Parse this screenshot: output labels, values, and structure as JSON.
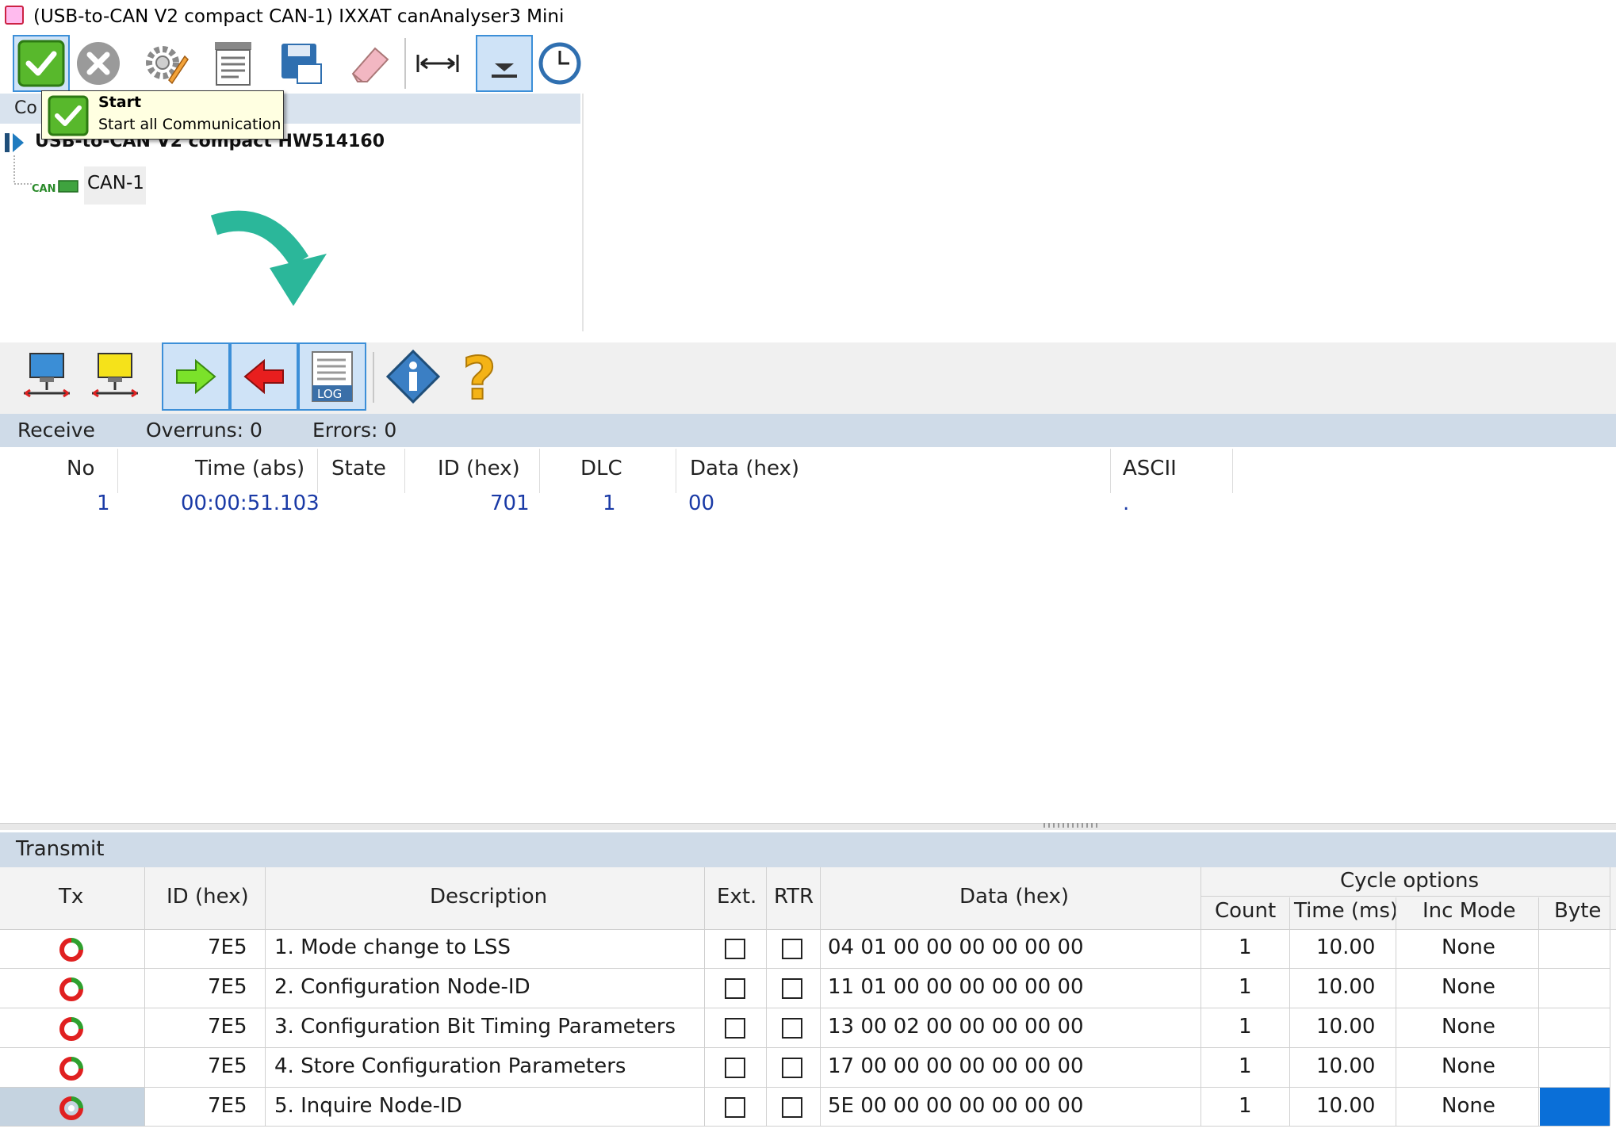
{
  "window": {
    "title": "(USB-to-CAN V2 compact  CAN-1) IXXAT canAnalyser3 Mini"
  },
  "toolbar": {
    "icons": [
      "start-check-icon",
      "stop-x-icon",
      "settings-gear-icon",
      "print-report-icon",
      "save-disk-icon",
      "eraser-icon",
      "width-arrows-icon",
      "autoscroll-icon",
      "clock-icon"
    ]
  },
  "tree": {
    "header": "Co",
    "device": "USB-to-CAN V2 compact  HW514160",
    "channel": "CAN-1"
  },
  "tooltip": {
    "title": "Start",
    "description": "Start all Communication"
  },
  "receive": {
    "label": "Receive",
    "overruns": "Overruns: 0",
    "errors": "Errors: 0",
    "columns": [
      "No",
      "Time (abs)",
      "State",
      "ID (hex)",
      "DLC",
      "Data (hex)",
      "ASCII"
    ],
    "rows": [
      {
        "no": "1",
        "time": "00:00:51.103",
        "state": "",
        "id": "701",
        "dlc": "1",
        "data": "00",
        "ascii": "."
      }
    ]
  },
  "transmit": {
    "label": "Transmit",
    "columns": {
      "tx": "Tx",
      "id": "ID (hex)",
      "description": "Description",
      "ext": "Ext.",
      "rtr": "RTR",
      "data": "Data (hex)",
      "cycle_group": "Cycle options",
      "count": "Count",
      "time": "Time (ms)",
      "inc_mode": "Inc Mode",
      "byte": "Byte"
    },
    "rows": [
      {
        "id": "7E5",
        "description": "1. Mode change to LSS",
        "data": "04 01 00 00 00 00 00 00",
        "count": "1",
        "time": "10.00",
        "inc_mode": "None"
      },
      {
        "id": "7E5",
        "description": "2. Configuration Node-ID",
        "data": "11 01 00 00 00 00 00 00",
        "count": "1",
        "time": "10.00",
        "inc_mode": "None"
      },
      {
        "id": "7E5",
        "description": "3. Configuration Bit Timing Parameters",
        "data": "13 00 02 00 00 00 00 00",
        "count": "1",
        "time": "10.00",
        "inc_mode": "None"
      },
      {
        "id": "7E5",
        "description": "4. Store Configuration Parameters",
        "data": "17 00 00 00 00 00 00 00",
        "count": "1",
        "time": "10.00",
        "inc_mode": "None"
      },
      {
        "id": "7E5",
        "description": "5. Inquire Node-ID",
        "data": "5E 00 00 00 00 00 00 00",
        "count": "1",
        "time": "10.00",
        "inc_mode": "None"
      }
    ]
  },
  "colors": {
    "accent_arrow": "#2bb79a",
    "selection": "#0a6fd8",
    "value_text": "#1a3aa6"
  }
}
